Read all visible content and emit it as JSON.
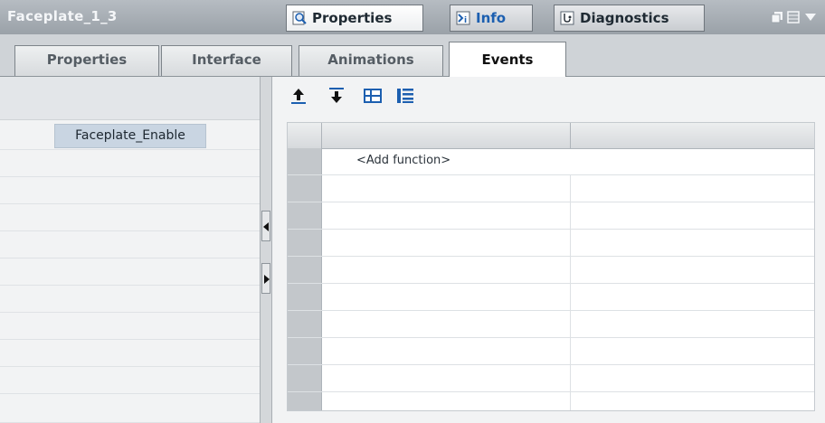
{
  "window": {
    "title": "Faceplate_1_3",
    "tabs": [
      {
        "label": "Properties",
        "icon": "properties-magnifier-icon",
        "active": true
      },
      {
        "label": "Info",
        "icon": "info-icon",
        "active": false
      },
      {
        "label": "Diagnostics",
        "icon": "diagnostics-icon",
        "active": false
      }
    ],
    "controls": [
      "float-window-icon",
      "layout-icon",
      "dropdown-arrow-icon"
    ]
  },
  "subtabs": [
    {
      "label": "Properties",
      "active": false
    },
    {
      "label": "Interface",
      "active": false
    },
    {
      "label": "Animations",
      "active": false
    },
    {
      "label": "Events",
      "active": true
    }
  ],
  "left_panel": {
    "items": [
      {
        "label": "Faceplate_Enable",
        "selected": true
      }
    ]
  },
  "toolbar": {
    "icons": [
      "move-up-icon",
      "move-down-icon",
      "insert-row-icon",
      "list-icon"
    ]
  },
  "grid": {
    "columns": [
      "",
      "",
      ""
    ],
    "rows": [
      {
        "text": "<Add function>"
      },
      {
        "text": ""
      },
      {
        "text": ""
      },
      {
        "text": ""
      },
      {
        "text": ""
      },
      {
        "text": ""
      },
      {
        "text": ""
      },
      {
        "text": ""
      },
      {
        "text": ""
      },
      {
        "text": ""
      }
    ]
  },
  "colors": {
    "accent": "#1c5fb0",
    "selection": "#c9d5e2"
  }
}
